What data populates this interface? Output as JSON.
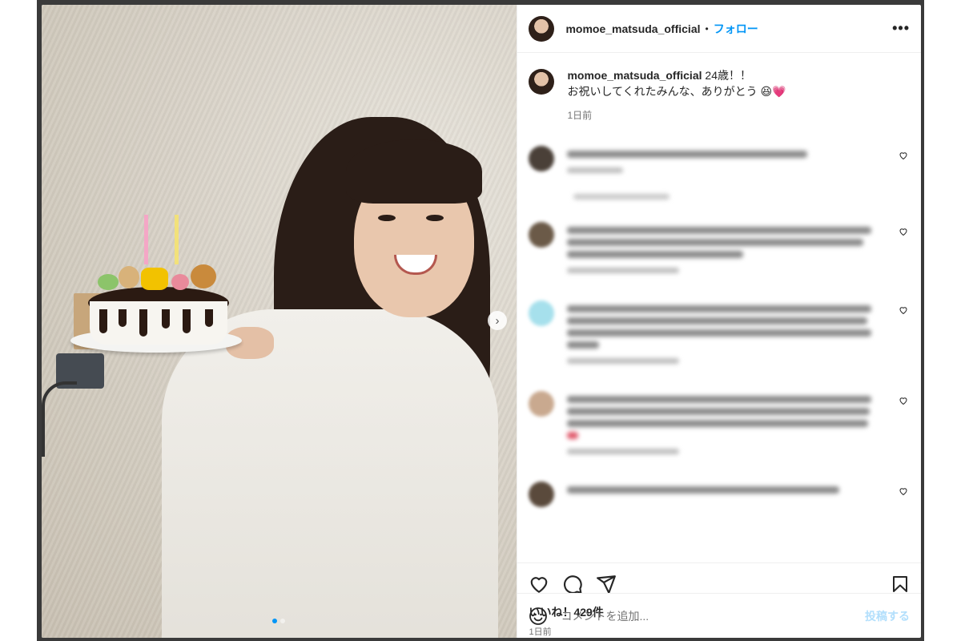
{
  "post": {
    "username": "momoe_matsuda_official",
    "separator": "•",
    "follow_label": "フォロー",
    "more_label": "•••",
    "caption_line1": "24歳！！",
    "caption_line2": "お祝いしてくれたみんな、ありがとう",
    "caption_emoji": "😆💗",
    "caption_time": "1日前",
    "likes": "いいね！429件",
    "time": "1日前",
    "carousel_next": "›",
    "image_count": 2,
    "current_image": 1
  },
  "comment_box": {
    "placeholder": "コメントを追加...",
    "post_label": "投稿する"
  },
  "icons": [
    "heart-icon",
    "comment-icon",
    "share-icon",
    "bookmark-icon",
    "emoji-icon",
    "more-icon"
  ],
  "colors": {
    "link": "#0095f6",
    "post_disabled": "#b2dffc",
    "secondary_text": "#737373"
  }
}
